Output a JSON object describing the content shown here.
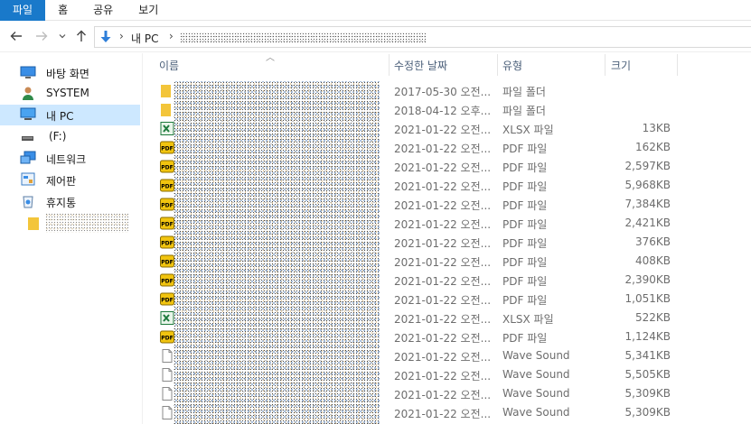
{
  "ribbon": {
    "tabs": [
      {
        "label": "파일",
        "active": true
      },
      {
        "label": "홈"
      },
      {
        "label": "공유"
      },
      {
        "label": "보기"
      }
    ]
  },
  "address": {
    "crumbs": [
      "내 PC"
    ]
  },
  "sidebar": {
    "items": [
      {
        "label": "바탕 화면",
        "icon": "desktop-icon"
      },
      {
        "label": "SYSTEM",
        "icon": "user-icon"
      },
      {
        "label": "내 PC",
        "icon": "computer-icon",
        "selected": true
      },
      {
        "label": "(F:)",
        "icon": "drive-icon"
      },
      {
        "label": "네트워크",
        "icon": "network-icon"
      },
      {
        "label": "제어판",
        "icon": "control-panel-icon"
      },
      {
        "label": "휴지통",
        "icon": "recycle-bin-icon"
      },
      {
        "label": "",
        "icon": "folder-icon"
      }
    ]
  },
  "columns": {
    "name": "이름",
    "date": "수정한 날짜",
    "type": "유형",
    "size": "크기"
  },
  "files": [
    {
      "icon": "folder-icon",
      "date": "2017-05-30 오전...",
      "type": "파일 폴더",
      "size": ""
    },
    {
      "icon": "folder-icon",
      "date": "2018-04-12 오후...",
      "type": "파일 폴더",
      "size": ""
    },
    {
      "icon": "xlsx-icon",
      "date": "2021-01-22 오전...",
      "type": "XLSX 파일",
      "size": "13KB"
    },
    {
      "icon": "pdf-icon",
      "date": "2021-01-22 오전...",
      "type": "PDF 파일",
      "size": "162KB"
    },
    {
      "icon": "pdf-icon",
      "date": "2021-01-22 오전...",
      "type": "PDF 파일",
      "size": "2,597KB"
    },
    {
      "icon": "pdf-icon",
      "date": "2021-01-22 오전...",
      "type": "PDF 파일",
      "size": "5,968KB"
    },
    {
      "icon": "pdf-icon",
      "date": "2021-01-22 오전...",
      "type": "PDF 파일",
      "size": "7,384KB"
    },
    {
      "icon": "pdf-icon",
      "date": "2021-01-22 오전...",
      "type": "PDF 파일",
      "size": "2,421KB"
    },
    {
      "icon": "pdf-icon",
      "date": "2021-01-22 오전...",
      "type": "PDF 파일",
      "size": "376KB"
    },
    {
      "icon": "pdf-icon",
      "date": "2021-01-22 오전...",
      "type": "PDF 파일",
      "size": "408KB"
    },
    {
      "icon": "pdf-icon",
      "date": "2021-01-22 오전...",
      "type": "PDF 파일",
      "size": "2,390KB"
    },
    {
      "icon": "pdf-icon",
      "date": "2021-01-22 오전...",
      "type": "PDF 파일",
      "size": "1,051KB"
    },
    {
      "icon": "xlsx-icon",
      "date": "2021-01-22 오전...",
      "type": "XLSX 파일",
      "size": "522KB"
    },
    {
      "icon": "pdf-icon",
      "date": "2021-01-22 오전...",
      "type": "PDF 파일",
      "size": "1,124KB"
    },
    {
      "icon": "wave-file-icon",
      "date": "2021-01-22 오전...",
      "type": "Wave Sound",
      "size": "5,341KB"
    },
    {
      "icon": "wave-file-icon",
      "date": "2021-01-22 오전...",
      "type": "Wave Sound",
      "size": "5,505KB"
    },
    {
      "icon": "wave-file-icon",
      "date": "2021-01-22 오전...",
      "type": "Wave Sound",
      "size": "5,309KB"
    },
    {
      "icon": "wave-file-icon",
      "date": "2021-01-22 오전...",
      "type": "Wave Sound",
      "size": "5,309KB"
    }
  ],
  "colors": {
    "accent": "#1979ca",
    "selection": "#cde8ff",
    "header_text": "#4c607a",
    "folder": "#f3c53a",
    "pdf": "#e8b400",
    "xlsx": "#1d7a3c"
  }
}
